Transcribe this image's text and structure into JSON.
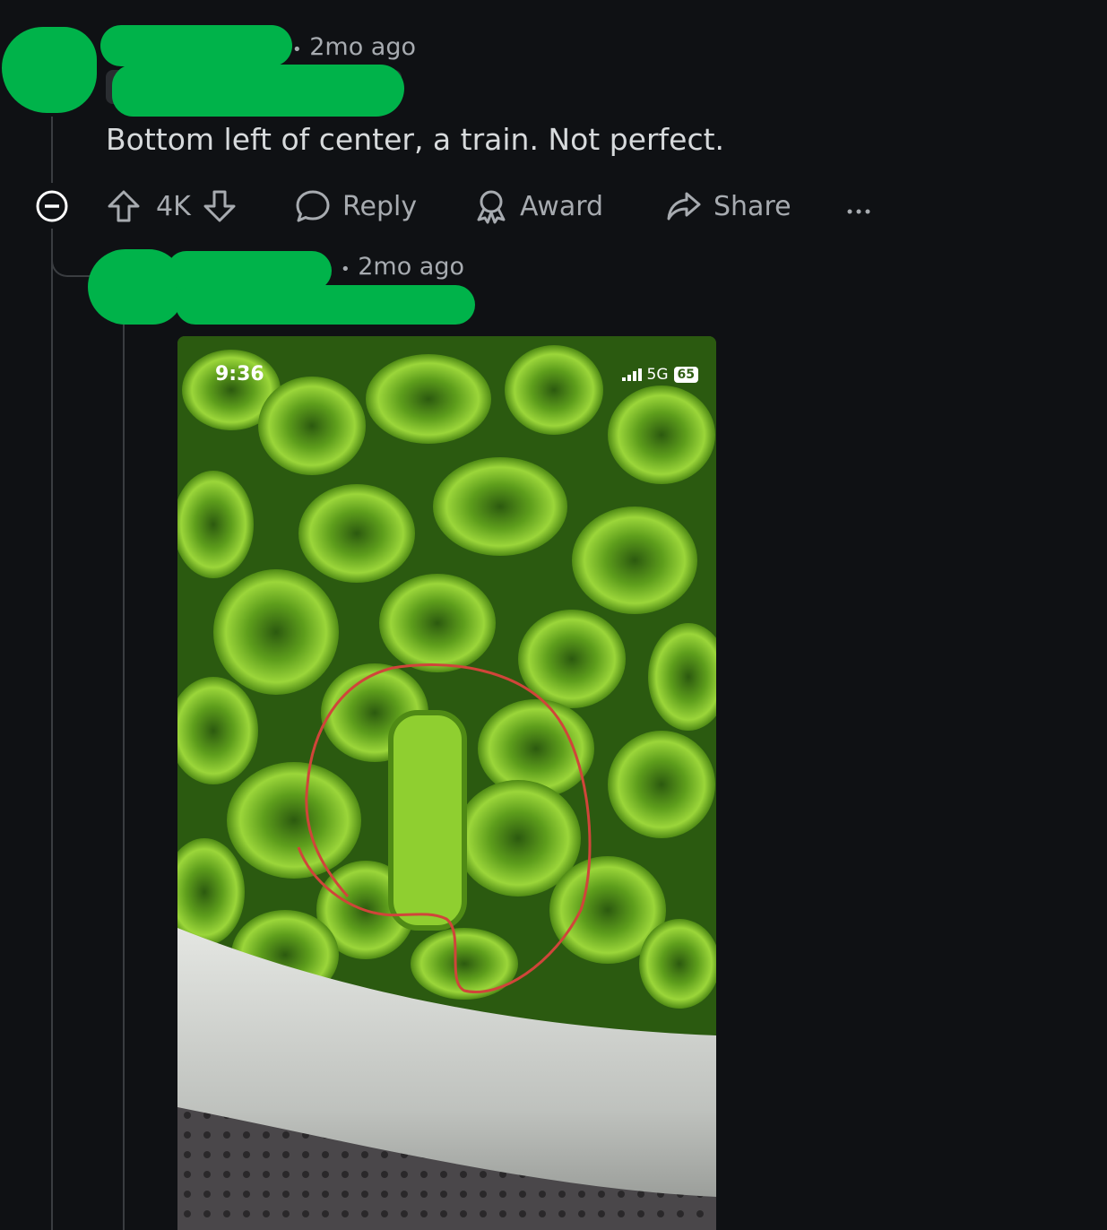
{
  "comment": {
    "timestamp": "2mo ago",
    "separator": "•",
    "text": "Bottom left of center, a train. Not perfect.",
    "actions": {
      "vote_count": "4K",
      "reply_label": "Reply",
      "award_label": "Award",
      "share_label": "Share"
    }
  },
  "reply": {
    "timestamp": "2mo ago",
    "separator": "•",
    "image": {
      "status_time": "9:36",
      "network": "5G",
      "battery": "65"
    }
  },
  "colors": {
    "background": "#0f1114",
    "redaction": "#00b34a",
    "annotation_circle": "#d0453a"
  },
  "icons": [
    "collapse-icon",
    "upvote-icon",
    "downvote-icon",
    "comment-icon",
    "award-icon",
    "share-icon",
    "more-icon",
    "signal-icon"
  ]
}
